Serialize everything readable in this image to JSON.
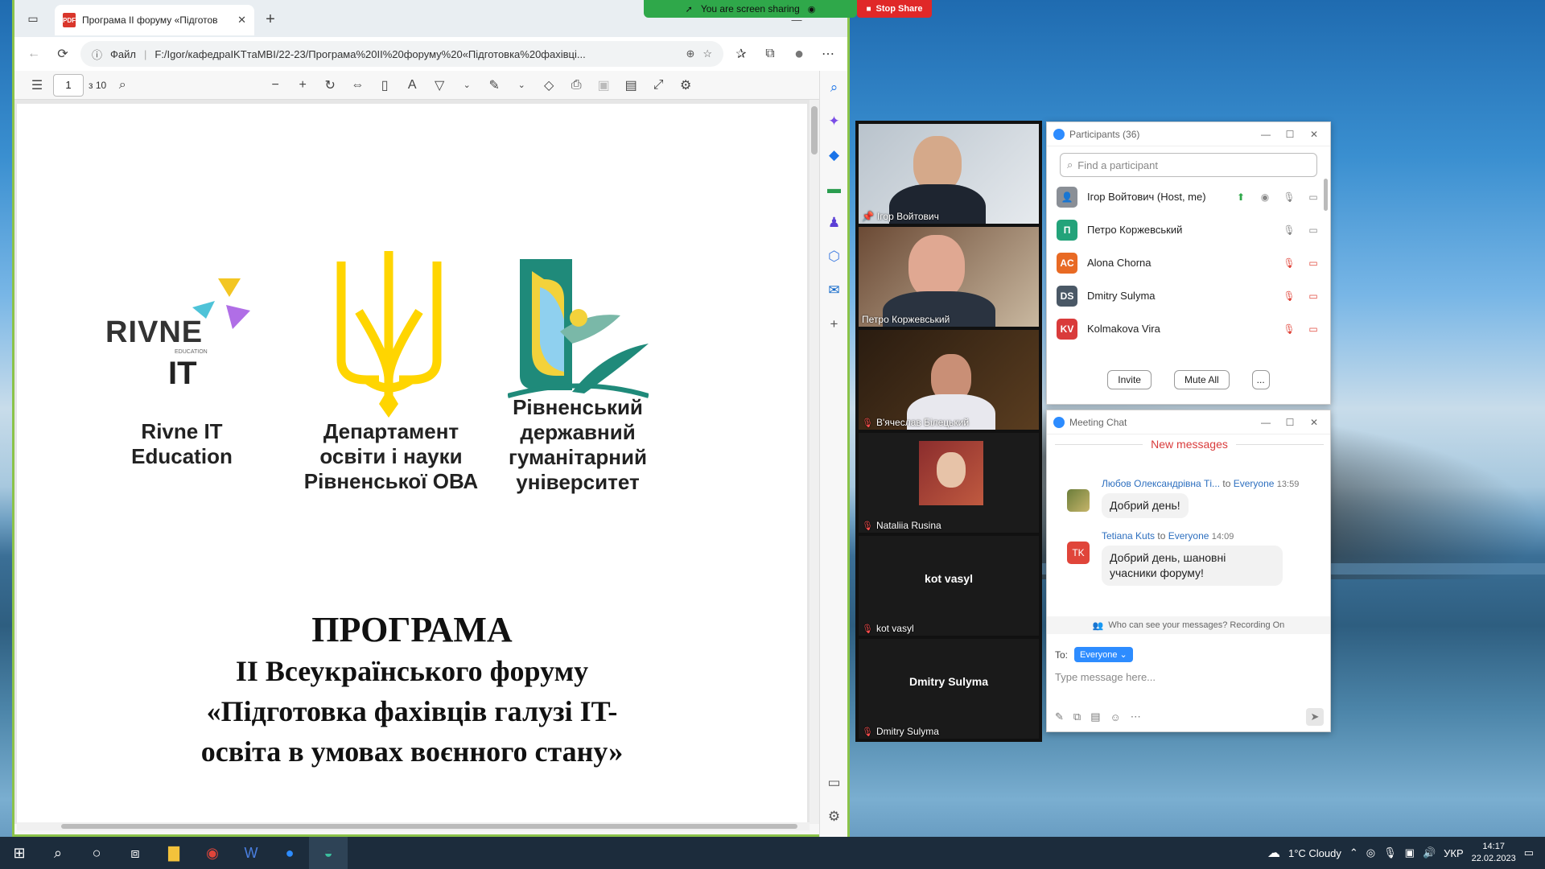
{
  "browser": {
    "tab_title": "Програма II форуму «Підготов",
    "address_prefix": "Файл",
    "address_url": "F:/Igor/кафедраIKТтаMBI/22-23/Програма%20II%20форуму%20«Підготовка%20фахівці...",
    "pdf_page_current": "1",
    "pdf_page_total": "з 10"
  },
  "document": {
    "logo1_word1": "RIVNE",
    "logo1_word2": "EDUCATION",
    "logo1_word3": "IT",
    "logo1_label": "Rivne IT Education",
    "logo2_label": "Департамент освіти і науки Рівненської ОВА",
    "logo3_label": "Рівненський державний гуманітарний університет",
    "title_line1": "ПРОГРАМА",
    "title_line2": "II Всеукраїнського форуму",
    "title_line3": "«Підготовка фахівців галузі IT-",
    "title_line4": "освіта в умовах воєнного стану»"
  },
  "share_banner": {
    "text": "You are screen sharing",
    "stop_label": "Stop Share"
  },
  "video_tiles": [
    {
      "name": "Ігор Войтович"
    },
    {
      "name": "Петро Коржевський"
    },
    {
      "name": "В'ячеслав Білецький"
    },
    {
      "name": "Nataliia Rusina"
    },
    {
      "name": "kot vasyl",
      "center_name": "kot vasyl"
    },
    {
      "name": "Dmitry Sulyma",
      "center_name": "Dmitry Sulyma"
    }
  ],
  "participants": {
    "title": "Participants (36)",
    "search_placeholder": "Find a participant",
    "list": [
      {
        "name": "Ігор Войтович (Host, me)",
        "initials": "",
        "color": "#8a8f96"
      },
      {
        "name": "Петро Коржевський",
        "initials": "П",
        "color": "#23a37a"
      },
      {
        "name": "Alona Chorna",
        "initials": "AC",
        "color": "#e86a24"
      },
      {
        "name": "Dmitry Sulyma",
        "initials": "DS",
        "color": "#4a5866"
      },
      {
        "name": "Kolmakova Vira",
        "initials": "KV",
        "color": "#d93b3b"
      }
    ],
    "invite_label": "Invite",
    "mute_all_label": "Mute All",
    "more_label": "..."
  },
  "chat": {
    "title": "Meeting Chat",
    "new_messages_label": "New messages",
    "messages": [
      {
        "sender": "Любов Олександрівна Ті...",
        "to_word": "to",
        "recipient": "Everyone",
        "time": "13:59",
        "text": "Добрий день!"
      },
      {
        "sender": "Tetiana Kuts",
        "to_word": "to",
        "recipient": "Everyone",
        "time": "14:09",
        "initials": "TK",
        "text": "Добрий день, шановні учасники форуму!"
      }
    ],
    "visibility_notice": "Who can see your messages? Recording On",
    "to_label": "To:",
    "to_value": "Everyone",
    "input_placeholder": "Type message here..."
  },
  "taskbar": {
    "weather": "1°C  Cloudy",
    "language": "УКР",
    "time": "14:17",
    "date": "22.02.2023"
  },
  "colors": {
    "edge_border": "#8bc34a",
    "zoom_blue": "#2d8cff",
    "stop_red": "#e02828",
    "share_green": "#2fa84a",
    "trident_yellow": "#ffd500",
    "taskbar": "#1c2c3c"
  }
}
